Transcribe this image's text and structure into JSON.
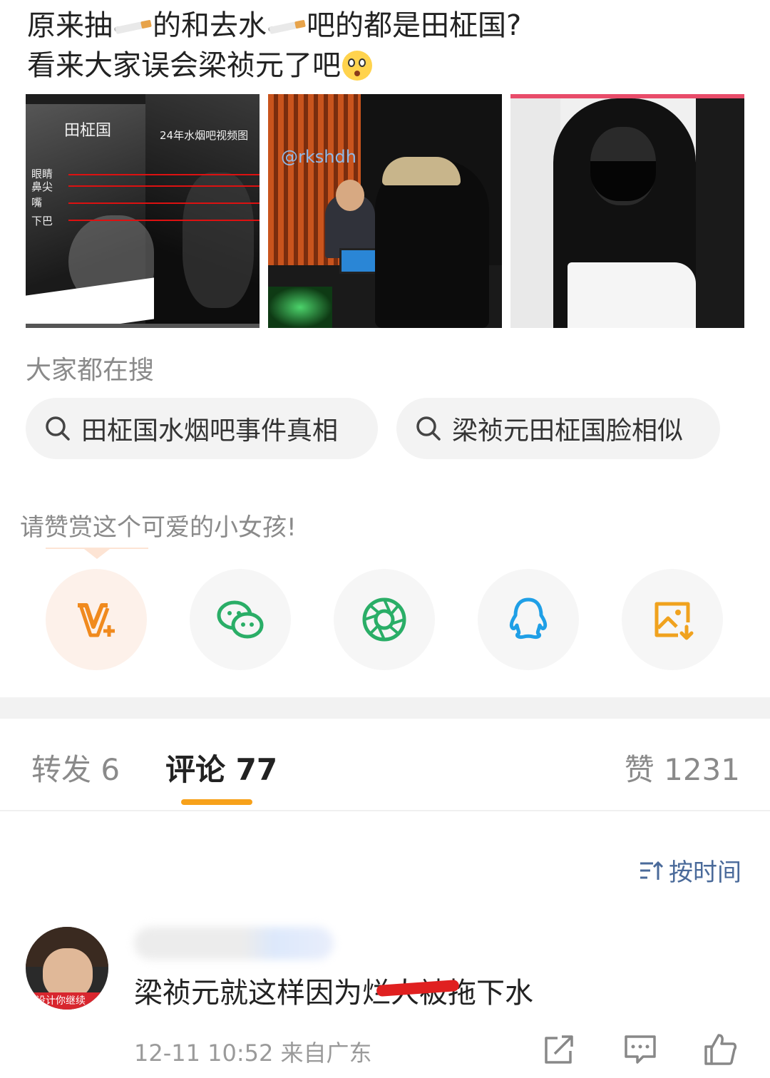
{
  "post": {
    "line1_a": "原来抽",
    "line1_b": "的和去水",
    "line1_c": "吧的都是田柾国?",
    "line2": "看来大家误会梁祯元了吧",
    "emoji": [
      "cigarette-emoji",
      "cigarette-emoji",
      "flushed-face-emoji"
    ]
  },
  "images": {
    "img1": {
      "label_name": "田柾国",
      "label_caption": "24年水烟吧视频图",
      "feature_labels": [
        "眼睛",
        "鼻尖",
        "嘴",
        "下巴"
      ]
    },
    "img2": {
      "watermark": "@rkshdh"
    }
  },
  "search": {
    "title": "大家都在搜",
    "chips": [
      "田柾国水烟吧事件真相",
      "梁祯元田柾国脸相似"
    ]
  },
  "reward": {
    "title": "请赞赏这个可爱的小女孩!",
    "buttons": [
      "v-plus-icon",
      "wechat-icon",
      "moments-icon",
      "qq-icon",
      "save-image-icon"
    ]
  },
  "tabs": {
    "repost": "转发 6",
    "comment": "评论 77",
    "like": "赞 1231"
  },
  "sort_label": "按时间",
  "comment": {
    "avatar_caption": "设计你继续",
    "text": "梁祯元就这样因为烂人被拖下水",
    "time": "12-11 10:52",
    "location": "来自广东"
  },
  "colors": {
    "accent_orange": "#f7a11a",
    "wechat_green": "#2aae67",
    "qq_blue": "#1f9fe6",
    "link_blue": "#4a6a9a"
  }
}
